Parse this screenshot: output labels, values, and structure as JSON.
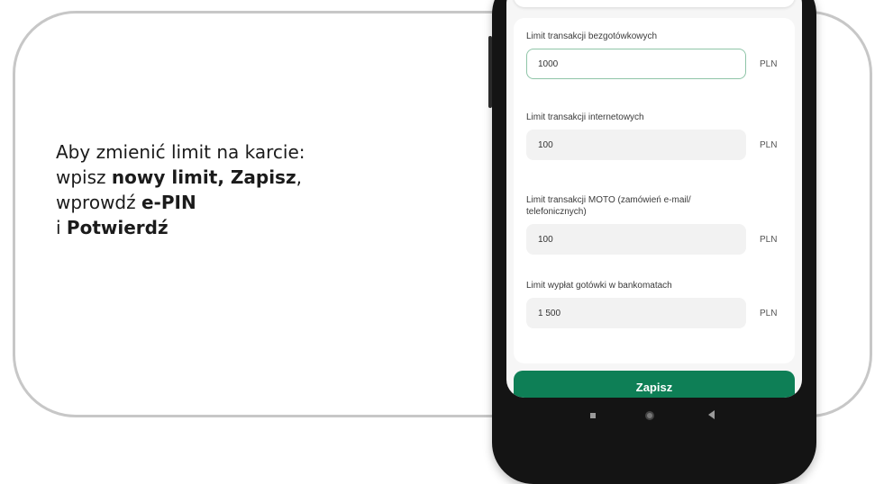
{
  "instructions": {
    "line1": "Aby zmienić limit na karcie:",
    "line2_prefix": "wpisz ",
    "line2_bold": "nowy limit, Zapisz",
    "line2_suffix": ",",
    "line3_prefix": "wprowdź ",
    "line3_bold": "e-PIN",
    "line4_prefix": "i ",
    "line4_bold": "Potwierdź"
  },
  "form": {
    "fields": [
      {
        "label": "Limit transakcji bezgotówkowych",
        "value": "1000",
        "unit": "PLN"
      },
      {
        "label": "Limit transakcji internetowych",
        "value": "100",
        "unit": "PLN"
      },
      {
        "label": "Limit transakcji MOTO (zamówień e-mail/ telefonicznych)",
        "value": "100",
        "unit": "PLN"
      },
      {
        "label": "Limit wypłat gotówki w bankomatach",
        "value": "1 500",
        "unit": "PLN"
      }
    ],
    "save_label": "Zapisz"
  },
  "colors": {
    "accent": "#0e7f56",
    "active_border": "#8fc5a8"
  },
  "icons": {
    "nav_recent": "square-icon",
    "nav_home": "circle-icon",
    "nav_back": "triangle-back-icon"
  }
}
